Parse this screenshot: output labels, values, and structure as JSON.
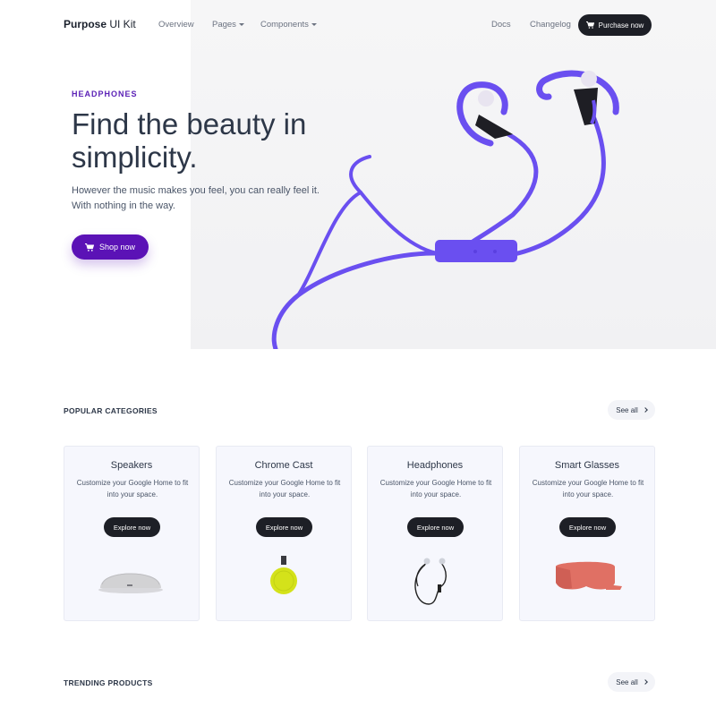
{
  "navbar": {
    "brand_main": "Purpose",
    "brand_suffix": " UI Kit",
    "links": [
      {
        "label": "Overview"
      },
      {
        "label": "Pages"
      },
      {
        "label": "Components"
      }
    ],
    "right_links": [
      {
        "label": "Docs"
      },
      {
        "label": "Changelog"
      }
    ],
    "purchase_label": "Purchase now"
  },
  "hero": {
    "eyebrow": "HEADPHONES",
    "title": "Find the beauty in simplicity.",
    "subtitle": "However the music makes you feel, you can really feel it. With nothing in the way.",
    "cta_label": "Shop now",
    "accent": "#5b12b6",
    "cable_color": "#6a4ff0"
  },
  "popular": {
    "title": "POPULAR CATEGORIES",
    "see_all": "See all",
    "cards": [
      {
        "title": "Speakers",
        "desc": "Customize your Google Home to fit into your space.",
        "button": "Explore now",
        "icon": "speaker-icon"
      },
      {
        "title": "Chrome Cast",
        "desc": "Customize your Google Home to fit into your space.",
        "button": "Explore now",
        "icon": "chromecast-icon"
      },
      {
        "title": "Headphones",
        "desc": "Customize your Google Home to fit into your space.",
        "button": "Explore now",
        "icon": "earbuds-icon"
      },
      {
        "title": "Smart Glasses",
        "desc": "Customize your Google Home to fit into your space.",
        "button": "Explore now",
        "icon": "vr-headset-icon"
      }
    ]
  },
  "trending": {
    "title": "TRENDING PRODUCTS",
    "see_all": "See all"
  }
}
